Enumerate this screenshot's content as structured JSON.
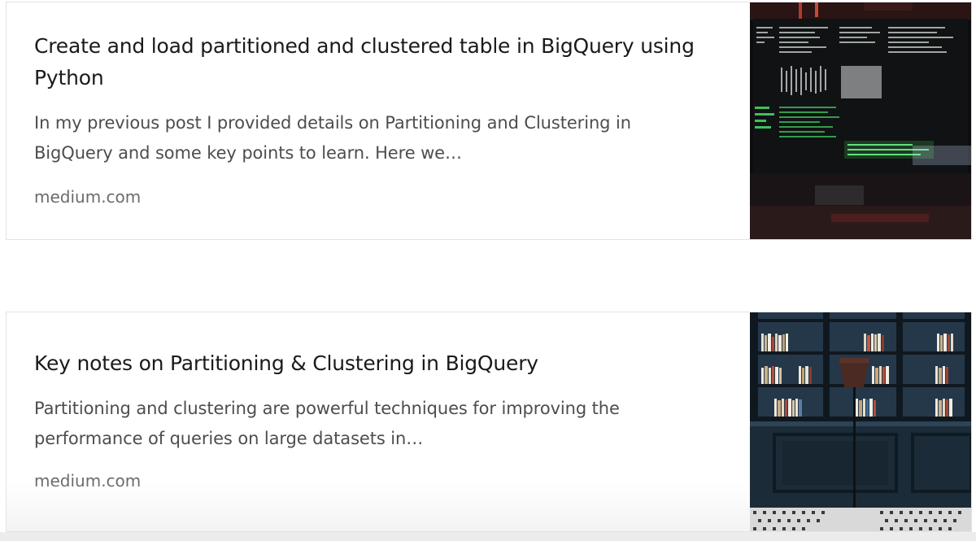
{
  "cards": [
    {
      "title_line1": "Create and load partitioned and clustered table in BigQuery using",
      "title_line2": "Python",
      "description_line1": "In my previous post I provided details on Partitioning and Clustering in",
      "description_line2": "BigQuery and some key points to learn. Here we…",
      "source": "medium.com",
      "thumbnail_icon": "code-monitor-photo"
    },
    {
      "title_line1": "Key notes on Partitioning & Clustering in BigQuery",
      "description_line1": "Partitioning and clustering are powerful techniques for improving the",
      "description_line2": "performance of queries on large datasets in…",
      "source": "medium.com",
      "thumbnail_icon": "bookshelf-lamp-photo"
    }
  ]
}
